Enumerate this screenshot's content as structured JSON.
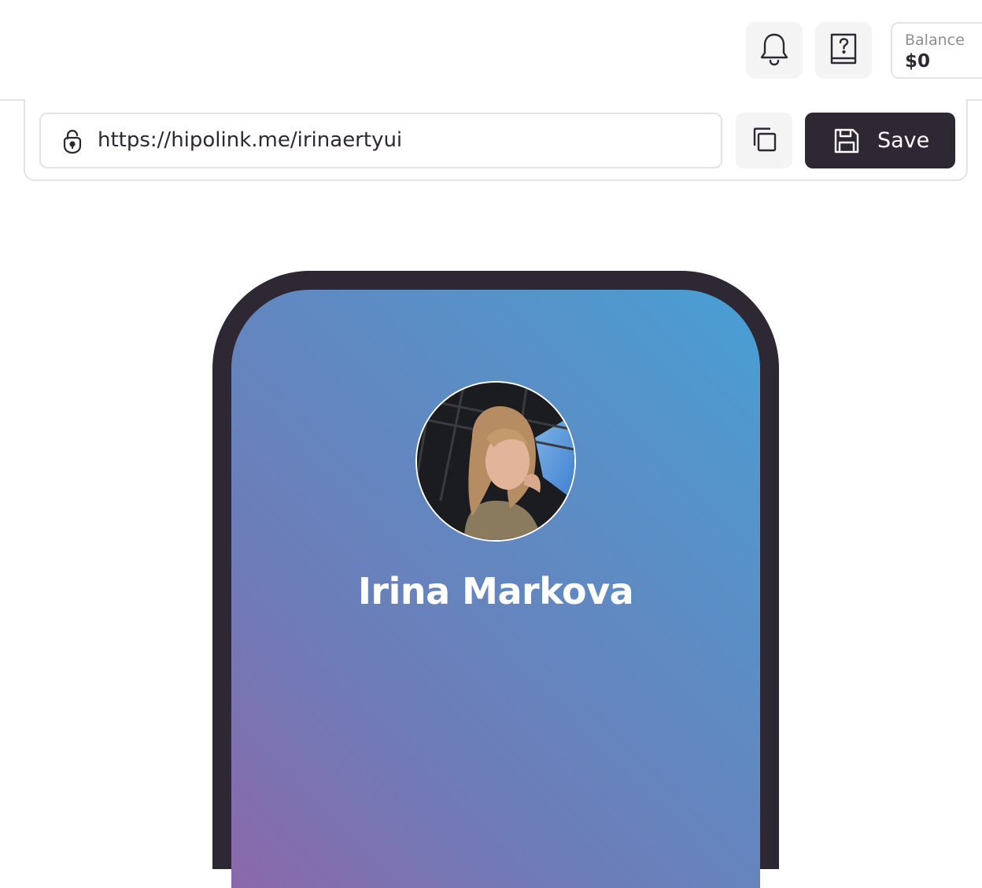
{
  "header": {
    "notifications_icon": "bell-icon",
    "help_icon": "help-book-icon",
    "balance": {
      "label": "Balance",
      "value": "$0"
    }
  },
  "link_bar": {
    "url": "https://hipolink.me/irinaertyui",
    "lock_icon": "lock-icon",
    "copy_icon": "copy-icon",
    "save_icon": "floppy-disk-icon",
    "save_label": "Save"
  },
  "preview": {
    "profile_name": "Irina Markova",
    "gradient_colors": [
      "#8b68aa",
      "#489fd4"
    ],
    "frame_color": "#2d2833"
  }
}
